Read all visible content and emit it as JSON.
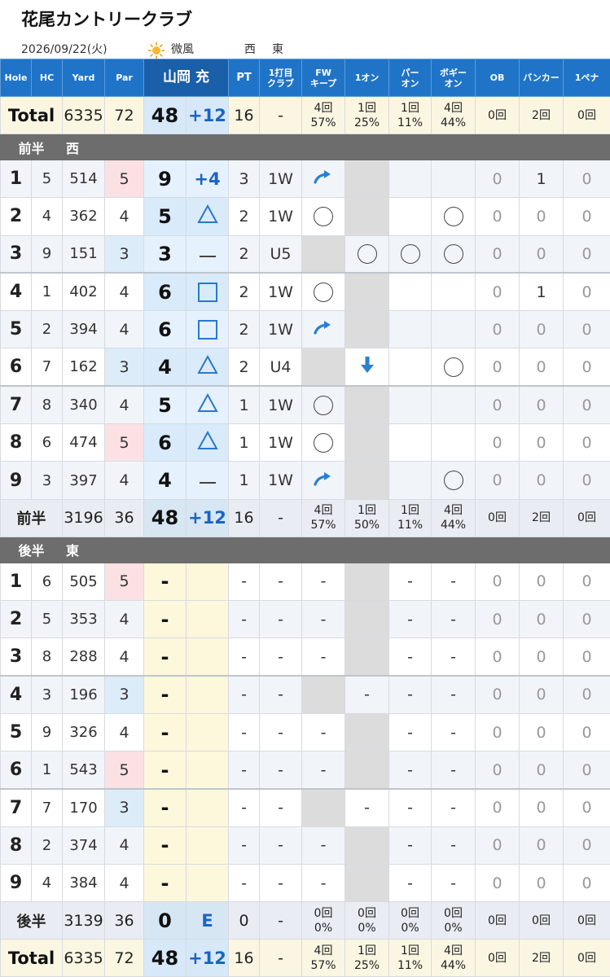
{
  "app_title": "花尾カントリークラブ",
  "info": {
    "date": "2026/09/22(火)",
    "weather_icon": "sun-icon",
    "wind": "微風",
    "course1": "西",
    "course2": "東"
  },
  "headers": {
    "hole": "Hole",
    "hc": "HC",
    "yard": "Yard",
    "par": "Par",
    "player": "山岡 充",
    "pt": "PT",
    "club_l1": "1打目",
    "club_l2": "クラブ",
    "fw_l1": "FW",
    "fw_l2": "キープ",
    "oneon": "1オン",
    "paron_l1": "パー",
    "paron_l2": "オン",
    "bogey_l1": "ボギー",
    "bogey_l2": "オン",
    "ob": "OB",
    "bunker": "バンカー",
    "penalty": "1ペナ"
  },
  "total_top": {
    "label": "Total",
    "yard": "6335",
    "par": "72",
    "score": "48",
    "over": "+12",
    "pt": "16",
    "club": "-",
    "fw_l1": "4回",
    "fw_l2": "57%",
    "oneon_l1": "1回",
    "oneon_l2": "25%",
    "paron_l1": "1回",
    "paron_l2": "11%",
    "bogey_l1": "4回",
    "bogey_l2": "44%",
    "ob": "0回",
    "bunker": "2回",
    "penalty": "0回"
  },
  "front": {
    "label": "前半",
    "course": "西",
    "holes": [
      {
        "no": "1",
        "hc": "5",
        "yard": "514",
        "par": "5",
        "score": "9",
        "over": "+4",
        "mark": "",
        "pt": "3",
        "club": "1W",
        "fw": "arrow",
        "oneon": "gray",
        "paron": "",
        "bogey": "",
        "ob": "0",
        "bunker": "1",
        "penalty": "0"
      },
      {
        "no": "2",
        "hc": "4",
        "yard": "362",
        "par": "4",
        "score": "5",
        "over": "",
        "mark": "tri",
        "pt": "2",
        "club": "1W",
        "fw": "circle",
        "oneon": "gray",
        "paron": "",
        "bogey": "circle",
        "ob": "0",
        "bunker": "0",
        "penalty": "0"
      },
      {
        "no": "3",
        "hc": "9",
        "yard": "151",
        "par": "3",
        "score": "3",
        "over": "",
        "mark": "dash",
        "pt": "2",
        "club": "U5",
        "fw": "gray",
        "oneon": "circle",
        "paron": "circle",
        "bogey": "circle",
        "ob": "0",
        "bunker": "0",
        "penalty": "0"
      },
      {
        "no": "4",
        "hc": "1",
        "yard": "402",
        "par": "4",
        "score": "6",
        "over": "",
        "mark": "sq",
        "pt": "2",
        "club": "1W",
        "fw": "circle",
        "oneon": "gray",
        "paron": "",
        "bogey": "",
        "ob": "0",
        "bunker": "1",
        "penalty": "0"
      },
      {
        "no": "5",
        "hc": "2",
        "yard": "394",
        "par": "4",
        "score": "6",
        "over": "",
        "mark": "sq",
        "pt": "2",
        "club": "1W",
        "fw": "arrow",
        "oneon": "gray",
        "paron": "",
        "bogey": "",
        "ob": "0",
        "bunker": "0",
        "penalty": "0"
      },
      {
        "no": "6",
        "hc": "7",
        "yard": "162",
        "par": "3",
        "score": "4",
        "over": "",
        "mark": "tri",
        "pt": "2",
        "club": "U4",
        "fw": "gray",
        "oneon": "down",
        "paron": "",
        "bogey": "circle",
        "ob": "0",
        "bunker": "0",
        "penalty": "0"
      },
      {
        "no": "7",
        "hc": "8",
        "yard": "340",
        "par": "4",
        "score": "5",
        "over": "",
        "mark": "tri",
        "pt": "1",
        "club": "1W",
        "fw": "circle",
        "oneon": "gray",
        "paron": "",
        "bogey": "",
        "ob": "0",
        "bunker": "0",
        "penalty": "0"
      },
      {
        "no": "8",
        "hc": "6",
        "yard": "474",
        "par": "5",
        "score": "6",
        "over": "",
        "mark": "tri",
        "pt": "1",
        "club": "1W",
        "fw": "circle",
        "oneon": "gray",
        "paron": "",
        "bogey": "",
        "ob": "0",
        "bunker": "0",
        "penalty": "0"
      },
      {
        "no": "9",
        "hc": "3",
        "yard": "397",
        "par": "4",
        "score": "4",
        "over": "",
        "mark": "dash",
        "pt": "1",
        "club": "1W",
        "fw": "arrow",
        "oneon": "gray",
        "paron": "",
        "bogey": "circle",
        "ob": "0",
        "bunker": "0",
        "penalty": "0"
      }
    ],
    "summary": {
      "label": "前半",
      "yard": "3196",
      "par": "36",
      "score": "48",
      "over": "+12",
      "pt": "16",
      "club": "-",
      "fw_l1": "4回",
      "fw_l2": "57%",
      "oneon_l1": "1回",
      "oneon_l2": "50%",
      "paron_l1": "1回",
      "paron_l2": "11%",
      "bogey_l1": "4回",
      "bogey_l2": "44%",
      "ob": "0回",
      "bunker": "2回",
      "penalty": "0回"
    }
  },
  "back": {
    "label": "後半",
    "course": "東",
    "holes": [
      {
        "no": "1",
        "hc": "6",
        "yard": "505",
        "par": "5",
        "score": "-",
        "pt": "-",
        "club": "-",
        "fw": "-",
        "oneon": "gray",
        "paron": "-",
        "bogey": "-",
        "ob": "0",
        "bunker": "0",
        "penalty": "0"
      },
      {
        "no": "2",
        "hc": "5",
        "yard": "353",
        "par": "4",
        "score": "-",
        "pt": "-",
        "club": "-",
        "fw": "-",
        "oneon": "gray",
        "paron": "-",
        "bogey": "-",
        "ob": "0",
        "bunker": "0",
        "penalty": "0"
      },
      {
        "no": "3",
        "hc": "8",
        "yard": "288",
        "par": "4",
        "score": "-",
        "pt": "-",
        "club": "-",
        "fw": "-",
        "oneon": "gray",
        "paron": "-",
        "bogey": "-",
        "ob": "0",
        "bunker": "0",
        "penalty": "0"
      },
      {
        "no": "4",
        "hc": "3",
        "yard": "196",
        "par": "3",
        "score": "-",
        "pt": "-",
        "club": "-",
        "fw": "gray",
        "oneon": "-",
        "paron": "-",
        "bogey": "-",
        "ob": "0",
        "bunker": "0",
        "penalty": "0"
      },
      {
        "no": "5",
        "hc": "9",
        "yard": "326",
        "par": "4",
        "score": "-",
        "pt": "-",
        "club": "-",
        "fw": "-",
        "oneon": "gray",
        "paron": "-",
        "bogey": "-",
        "ob": "0",
        "bunker": "0",
        "penalty": "0"
      },
      {
        "no": "6",
        "hc": "1",
        "yard": "543",
        "par": "5",
        "score": "-",
        "pt": "-",
        "club": "-",
        "fw": "-",
        "oneon": "gray",
        "paron": "-",
        "bogey": "-",
        "ob": "0",
        "bunker": "0",
        "penalty": "0"
      },
      {
        "no": "7",
        "hc": "7",
        "yard": "170",
        "par": "3",
        "score": "-",
        "pt": "-",
        "club": "-",
        "fw": "gray",
        "oneon": "-",
        "paron": "-",
        "bogey": "-",
        "ob": "0",
        "bunker": "0",
        "penalty": "0"
      },
      {
        "no": "8",
        "hc": "2",
        "yard": "374",
        "par": "4",
        "score": "-",
        "pt": "-",
        "club": "-",
        "fw": "-",
        "oneon": "gray",
        "paron": "-",
        "bogey": "-",
        "ob": "0",
        "bunker": "0",
        "penalty": "0"
      },
      {
        "no": "9",
        "hc": "4",
        "yard": "384",
        "par": "4",
        "score": "-",
        "pt": "-",
        "club": "-",
        "fw": "-",
        "oneon": "gray",
        "paron": "-",
        "bogey": "-",
        "ob": "0",
        "bunker": "0",
        "penalty": "0"
      }
    ],
    "summary": {
      "label": "後半",
      "yard": "3139",
      "par": "36",
      "score": "0",
      "over": "E",
      "pt": "0",
      "club": "-",
      "fw_l1": "0回",
      "fw_l2": "0%",
      "oneon_l1": "0回",
      "oneon_l2": "0%",
      "paron_l1": "0回",
      "paron_l2": "0%",
      "bogey_l1": "0回",
      "bogey_l2": "0%",
      "ob": "0回",
      "bunker": "0回",
      "penalty": "0回"
    }
  },
  "total_bottom": {
    "label": "Total",
    "yard": "6335",
    "par": "72",
    "score": "48",
    "over": "+12",
    "pt": "16",
    "club": "-",
    "fw_l1": "4回",
    "fw_l2": "57%",
    "oneon_l1": "1回",
    "oneon_l2": "25%",
    "paron_l1": "1回",
    "paron_l2": "11%",
    "bogey_l1": "4回",
    "bogey_l2": "44%",
    "ob": "0回",
    "bunker": "2回",
    "penalty": "0回"
  },
  "colors": {
    "header_blue": "#1f74c8",
    "player_blue": "#1a5fa9",
    "section_gray": "#6d6d6d",
    "accent_blue": "#1a64c4",
    "total_bg": "#fbf6e2"
  }
}
